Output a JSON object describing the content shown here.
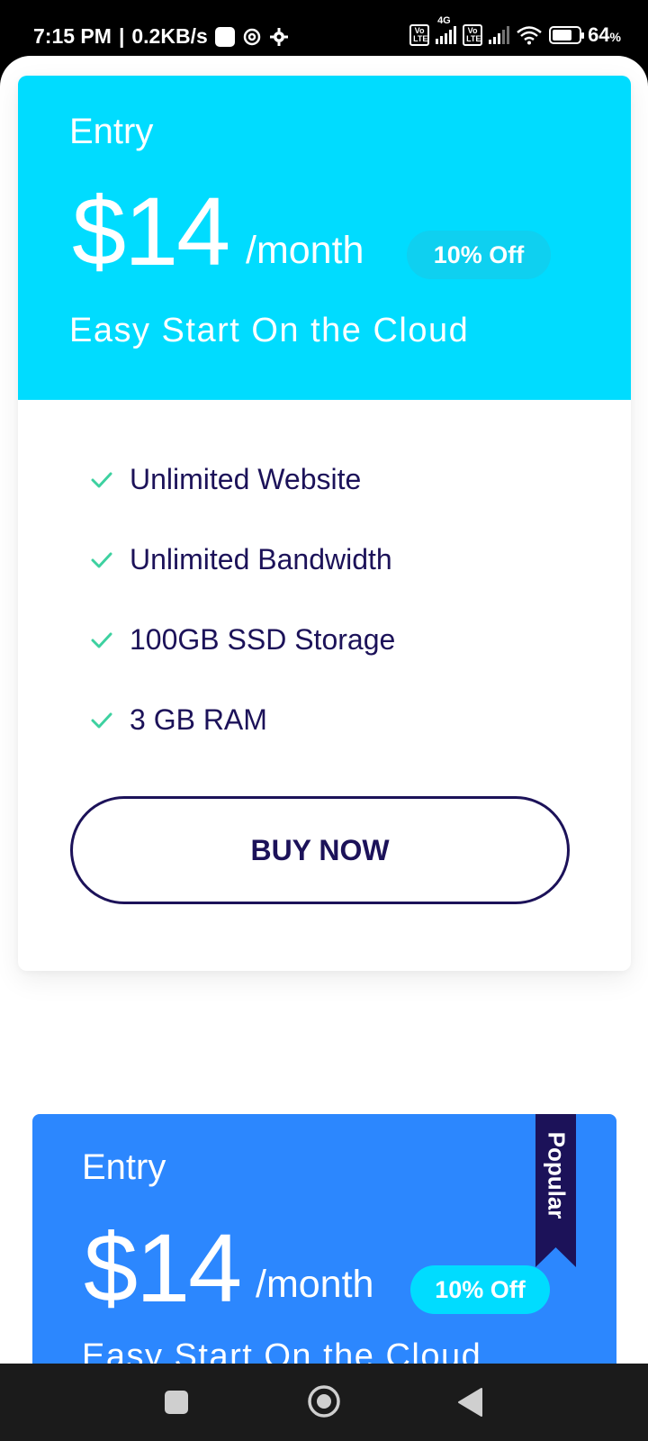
{
  "status_bar": {
    "time": "7:15 PM",
    "data_speed": "0.2KB/s",
    "network_label": "4G",
    "volte_label": "Vo LTE",
    "battery": "64",
    "battery_unit": "%"
  },
  "plans": [
    {
      "name": "Entry",
      "price": "$14",
      "period": "/month",
      "discount": "10% Off",
      "tagline": "Easy Start On the Cloud",
      "header_color": "#00dcff",
      "features": [
        "Unlimited Website",
        "Unlimited Bandwidth",
        "100GB SSD Storage",
        "3 GB RAM"
      ],
      "cta": "BUY NOW"
    },
    {
      "name": "Entry",
      "price": "$14",
      "period": "/month",
      "discount": "10% Off",
      "tagline": "Easy Start On the Cloud",
      "header_color": "#2c87fe",
      "badge": "Popular"
    }
  ],
  "colors": {
    "cyan": "#00dcff",
    "blue": "#2c87fe",
    "navy": "#1c1259",
    "check": "#3dd1a0"
  },
  "nav": {
    "recents_icon": "square-icon",
    "home_icon": "circle-icon",
    "back_icon": "triangle-back-icon"
  }
}
